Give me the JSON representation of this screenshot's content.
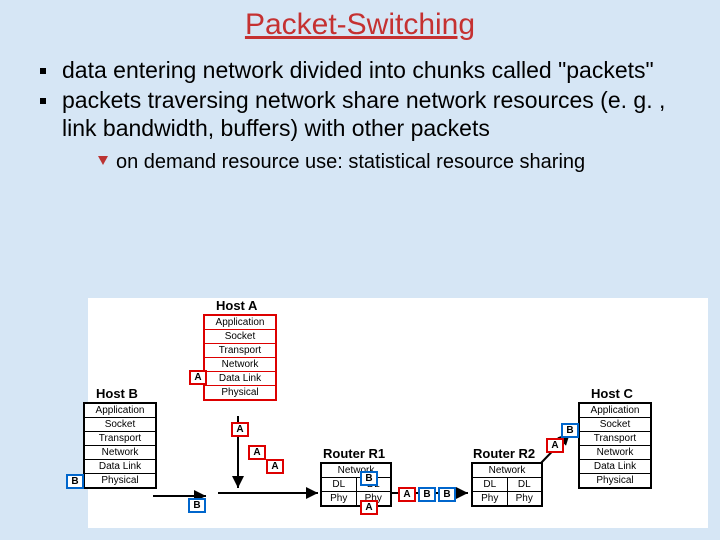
{
  "title": "Packet-Switching",
  "bullets": {
    "b1": "data entering network divided into chunks called \"packets\"",
    "b2": "packets traversing network share network resources (e. g. , link bandwidth, buffers) with other packets",
    "sub1": "on demand resource use: statistical resource sharing"
  },
  "diagram": {
    "hostA": "Host A",
    "hostB": "Host B",
    "hostC": "Host C",
    "routerR1": "Router R1",
    "routerR2": "Router R2",
    "layers": {
      "app": "Application",
      "sock": "Socket",
      "trans": "Transport",
      "net": "Network",
      "dl": "Data Link",
      "phy": "Physical",
      "net_s": "Network",
      "dl_s": "DL",
      "phy_s": "Phy"
    },
    "pkt": {
      "A": "A",
      "B": "B"
    }
  }
}
